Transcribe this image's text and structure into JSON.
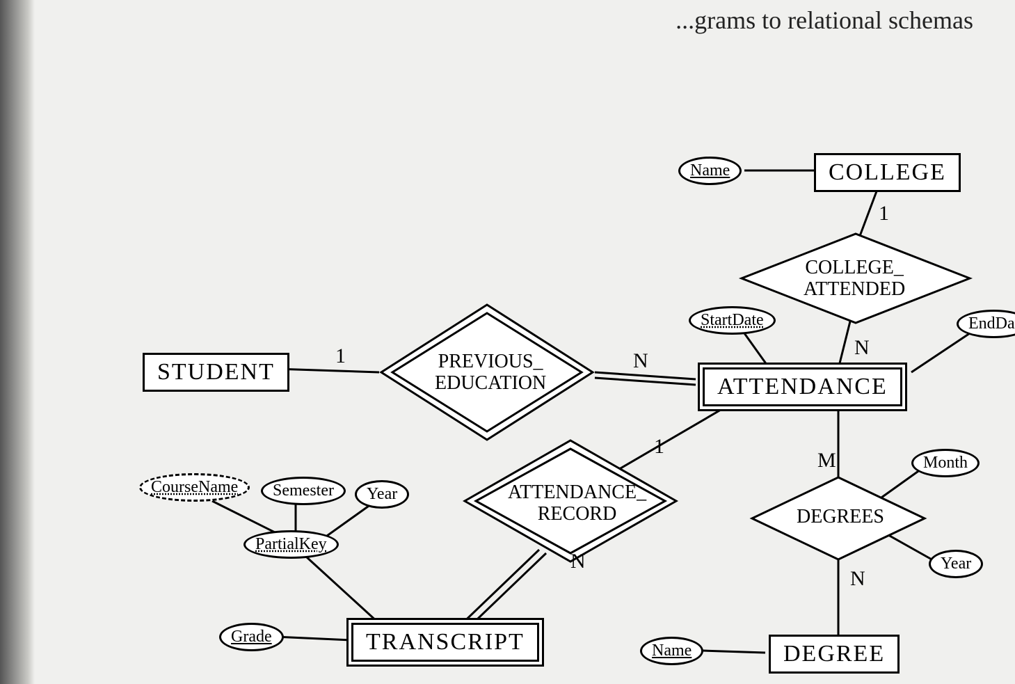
{
  "header": {
    "partial_text": "...grams to relational schemas"
  },
  "entities": {
    "student": {
      "label": "STUDENT"
    },
    "college": {
      "label": "COLLEGE"
    },
    "attendance": {
      "label": "ATTENDANCE"
    },
    "transcript": {
      "label": "TRANSCRIPT"
    },
    "degree": {
      "label": "DEGREE"
    }
  },
  "relationships": {
    "previous_education": {
      "line1": "PREVIOUS_",
      "line2": "EDUCATION"
    },
    "college_attended": {
      "line1": "COLLEGE_",
      "line2": "ATTENDED"
    },
    "attendance_record": {
      "line1": "ATTENDANCE_",
      "line2": "RECORD"
    },
    "degrees": {
      "line1": "DEGREES"
    }
  },
  "attributes": {
    "college_name": {
      "label": "Name"
    },
    "start_date": {
      "label": "StartDate"
    },
    "end_date": {
      "label": "EndDat"
    },
    "course_name": {
      "label": "CourseName"
    },
    "semester": {
      "label": "Semester"
    },
    "year_transcript": {
      "label": "Year"
    },
    "partial_key": {
      "label": "PartialKey"
    },
    "grade": {
      "label": "Grade"
    },
    "month": {
      "label": "Month"
    },
    "year_degree": {
      "label": "Year"
    },
    "degree_name": {
      "label": "Name"
    }
  },
  "cardinalities": {
    "student_prev": "1",
    "prev_attendance": "N",
    "college_attend": "1",
    "attend_attendance": "N",
    "attendance_rec_1": "1",
    "rec_transcript": "N",
    "degrees_m": "M",
    "degrees_n": "N"
  }
}
